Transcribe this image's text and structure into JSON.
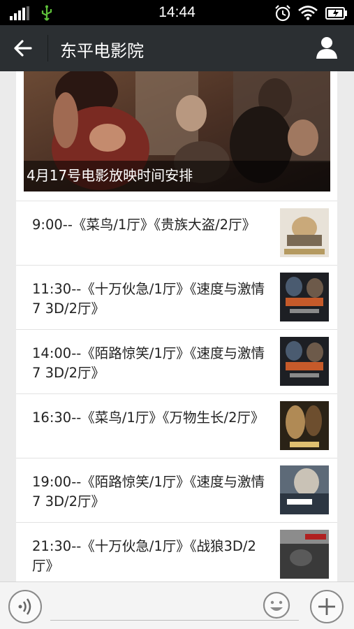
{
  "status_bar": {
    "time": "14:44",
    "icons": [
      "signal-icon",
      "usb-icon",
      "alarm-icon",
      "wifi-icon",
      "battery-icon"
    ]
  },
  "nav": {
    "back_icon": "arrow-left-icon",
    "title": "东平电影院",
    "profile_icon": "person-icon"
  },
  "cover": {
    "caption": "4月17号电影放映时间安排"
  },
  "schedule": [
    {
      "text": "9:00--《菜鸟/1厅》《贵族大盗/2厅》",
      "thumb_colors": [
        "#e8e2d8",
        "#c9a97a",
        "#7a6a55"
      ]
    },
    {
      "text": "11:30--《十万伙急/1厅》《速度与激情7 3D/2厅》",
      "thumb_colors": [
        "#1d1f24",
        "#c65a2a",
        "#4a5b70"
      ]
    },
    {
      "text": "14:00--《陌路惊笑/1厅》《速度与激情7 3D/2厅》",
      "thumb_colors": [
        "#1d1f24",
        "#c65a2a",
        "#4a5b70"
      ]
    },
    {
      "text": "16:30--《菜鸟/1厅》《万物生长/2厅》",
      "thumb_colors": [
        "#2a2216",
        "#b08a55",
        "#6d4e2e"
      ]
    },
    {
      "text": "19:00--《陌路惊笑/1厅》《速度与激情7 3D/2厅》",
      "thumb_colors": [
        "#5d6a78",
        "#c9c2b6",
        "#2c3642"
      ]
    },
    {
      "text": "21:30--《十万伙急/1厅》《战狼3D/2厅》",
      "thumb_colors": [
        "#3a3a3a",
        "#b02020",
        "#8c8c8c"
      ]
    }
  ],
  "input_bar": {
    "voice_icon": "voice-icon",
    "emoji_icon": "emoji-icon",
    "plus_icon": "plus-icon"
  }
}
